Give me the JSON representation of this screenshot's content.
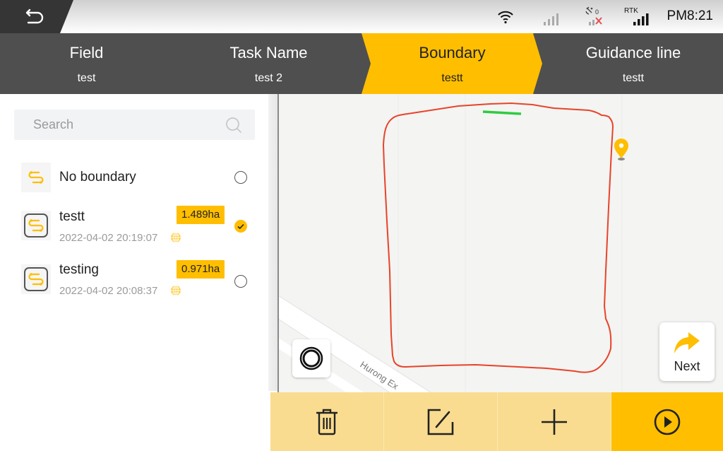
{
  "status_bar": {
    "back_icon": "back-arrow-icon",
    "wifi_icon": "wifi-icon",
    "cell_signal_icon": "cell-signal-icon",
    "satellite_icon": "satellite-icon",
    "satellite_count": "0",
    "rtk_label": "RTK",
    "rtk_signal_icon": "rtk-signal-icon",
    "time": "PM8:21"
  },
  "steps": [
    {
      "title": "Field",
      "value": "test",
      "active": false
    },
    {
      "title": "Task Name",
      "value": "test 2",
      "active": false
    },
    {
      "title": "Boundary",
      "value": "testt",
      "active": true
    },
    {
      "title": "Guidance line",
      "value": "testt",
      "active": false
    }
  ],
  "search": {
    "placeholder": "Search",
    "value": ""
  },
  "boundaries": [
    {
      "name": "No boundary",
      "area": "",
      "date": "",
      "selected": false,
      "icon": "route-icon"
    },
    {
      "name": "testt",
      "area": "1.489ha",
      "date": "2022-04-02 20:19:07",
      "selected": true,
      "icon": "route-icon"
    },
    {
      "name": "testing",
      "area": "0.971ha",
      "date": "2022-04-02 20:08:37",
      "selected": false,
      "icon": "route-icon"
    }
  ],
  "map": {
    "road_label": "Hurong Ex",
    "boundary_color": "#e8432a",
    "current_segment_color": "#2ecc40",
    "marker_color": "#ffbe00"
  },
  "next_button": {
    "label": "Next"
  },
  "toolbar": {
    "delete_icon": "trash-icon",
    "edit_icon": "edit-icon",
    "add_icon": "plus-icon",
    "play_icon": "play-icon"
  },
  "colors": {
    "accent": "#ffbe00",
    "accent_light": "#f9dc8f",
    "header_dark": "#4f4f4f"
  }
}
